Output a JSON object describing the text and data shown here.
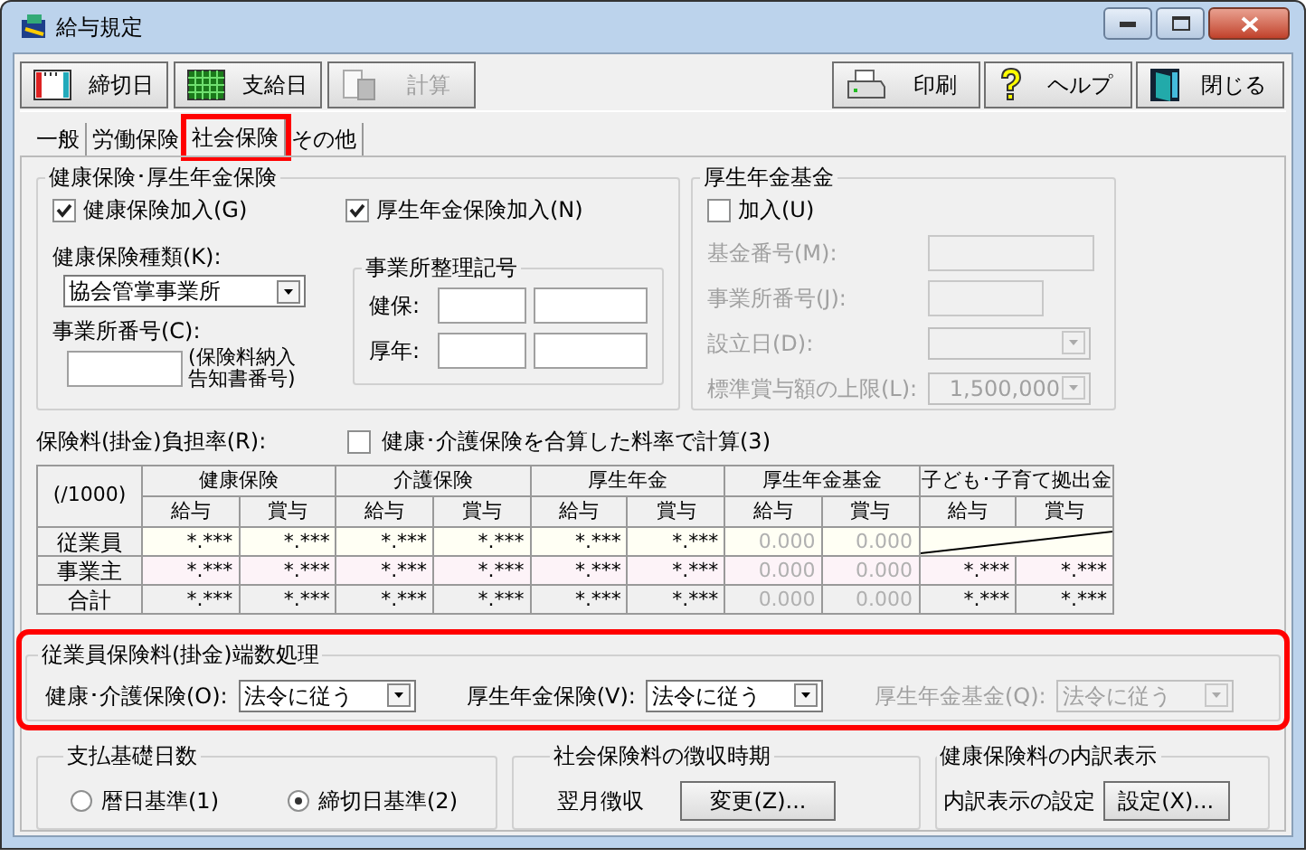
{
  "window": {
    "title": "給与規定"
  },
  "toolbar_left": [
    {
      "label": "締切日",
      "kind": "cutoff",
      "disabled": false
    },
    {
      "label": "支給日",
      "kind": "payday",
      "disabled": false
    },
    {
      "label": "計算",
      "kind": "calc",
      "disabled": true
    }
  ],
  "toolbar_right": [
    {
      "label": "印刷",
      "kind": "print"
    },
    {
      "label": "ヘルプ",
      "kind": "help"
    },
    {
      "label": "閉じる",
      "kind": "close"
    }
  ],
  "tabs": [
    {
      "label": "一般",
      "selected": false,
      "highlighted": false
    },
    {
      "label": "労働保険",
      "selected": false,
      "highlighted": false
    },
    {
      "label": "社会保険",
      "selected": true,
      "highlighted": true
    },
    {
      "label": "その他",
      "selected": false,
      "highlighted": false
    }
  ],
  "health_pension": {
    "title": "健康保険･厚生年金保険",
    "checks": [
      {
        "label": "健康保険加入(G)",
        "checked": true
      },
      {
        "label": "厚生年金保険加入(N)",
        "checked": true
      }
    ],
    "type_label": "健康保険種類(K):",
    "type_value": "協会管掌事業所",
    "office_label": "事業所番号(C):",
    "office_note": "(保険料納入告知書番号)",
    "symbol": {
      "title": "事業所整理記号",
      "rows": [
        {
          "label": "健保:"
        },
        {
          "label": "厚年:"
        }
      ]
    }
  },
  "pension_fund": {
    "title": "厚生年金基金",
    "join": {
      "label": "加入(U)",
      "checked": false
    },
    "fields": [
      {
        "label": "基金番号(M):",
        "kind": "input",
        "disabled": true
      },
      {
        "label": "事業所番号(J):",
        "kind": "input",
        "disabled": true
      },
      {
        "label": "設立日(D):",
        "kind": "select",
        "disabled": true
      },
      {
        "label": "標準賞与額の上限(L):",
        "kind": "select",
        "value": "1,500,000",
        "disabled": true
      }
    ]
  },
  "rates": {
    "label": "保険料(掛金)負担率(R):",
    "combine": {
      "label": "健康･介護保険を合算した料率で計算(3)",
      "checked": false
    },
    "corner": "(/1000)",
    "groups": [
      {
        "label": "健康保険",
        "subs": [
          "給与",
          "賞与"
        ]
      },
      {
        "label": "介護保険",
        "subs": [
          "給与",
          "賞与"
        ]
      },
      {
        "label": "厚生年金",
        "subs": [
          "給与",
          "賞与"
        ]
      },
      {
        "label": "厚生年金基金",
        "subs": [
          "給与",
          "賞与"
        ]
      },
      {
        "label": "子ども･子育て拠出金",
        "subs": [
          "給与",
          "賞与"
        ]
      }
    ],
    "rows": [
      {
        "label": "従業員",
        "kind": "employee",
        "cells": [
          {
            "kind": "value",
            "text": "*.***",
            "disabled": false
          },
          {
            "kind": "value",
            "text": "*.***",
            "disabled": false
          },
          {
            "kind": "value",
            "text": "*.***",
            "disabled": false
          },
          {
            "kind": "value",
            "text": "*.***",
            "disabled": false
          },
          {
            "kind": "value",
            "text": "*.***",
            "disabled": false
          },
          {
            "kind": "value",
            "text": "*.***",
            "disabled": false
          },
          {
            "kind": "value",
            "text": "0.000",
            "disabled": true
          },
          {
            "kind": "value",
            "text": "0.000",
            "disabled": true
          },
          {
            "kind": "slash"
          }
        ]
      },
      {
        "label": "事業主",
        "kind": "employer",
        "cells": [
          {
            "kind": "value",
            "text": "*.***",
            "disabled": false
          },
          {
            "kind": "value",
            "text": "*.***",
            "disabled": false
          },
          {
            "kind": "value",
            "text": "*.***",
            "disabled": false
          },
          {
            "kind": "value",
            "text": "*.***",
            "disabled": false
          },
          {
            "kind": "value",
            "text": "*.***",
            "disabled": false
          },
          {
            "kind": "value",
            "text": "*.***",
            "disabled": false
          },
          {
            "kind": "value",
            "text": "0.000",
            "disabled": true
          },
          {
            "kind": "value",
            "text": "0.000",
            "disabled": true
          },
          {
            "kind": "value",
            "text": "*.***",
            "disabled": false
          },
          {
            "kind": "value",
            "text": "*.***",
            "disabled": false
          }
        ]
      },
      {
        "label": "合計",
        "kind": "total",
        "cells": [
          {
            "kind": "value",
            "text": "*.***",
            "disabled": false
          },
          {
            "kind": "value",
            "text": "*.***",
            "disabled": false
          },
          {
            "kind": "value",
            "text": "*.***",
            "disabled": false
          },
          {
            "kind": "value",
            "text": "*.***",
            "disabled": false
          },
          {
            "kind": "value",
            "text": "*.***",
            "disabled": false
          },
          {
            "kind": "value",
            "text": "*.***",
            "disabled": false
          },
          {
            "kind": "value",
            "text": "0.000",
            "disabled": true
          },
          {
            "kind": "value",
            "text": "0.000",
            "disabled": true
          },
          {
            "kind": "value",
            "text": "*.***",
            "disabled": false
          },
          {
            "kind": "value",
            "text": "*.***",
            "disabled": false
          }
        ]
      }
    ]
  },
  "rounding": {
    "title": "従業員保険料(掛金)端数処理",
    "highlighted": true,
    "items": [
      {
        "label": "健康･介護保険(O):",
        "value": "法令に従う",
        "disabled": false
      },
      {
        "label": "厚生年金保険(V):",
        "value": "法令に従う",
        "disabled": false
      },
      {
        "label": "厚生年金基金(Q):",
        "value": "法令に従う",
        "disabled": true
      }
    ]
  },
  "pay_days": {
    "title": "支払基礎日数",
    "options": [
      {
        "label": "暦日基準(1)",
        "selected": false
      },
      {
        "label": "締切日基準(2)",
        "selected": true
      }
    ]
  },
  "collection": {
    "title": "社会保険料の徴収時期",
    "value": "翌月徴収",
    "button": "変更(Z)..."
  },
  "breakdown": {
    "title": "健康保険料の内訳表示",
    "label": "内訳表示の設定",
    "button": "設定(X)..."
  }
}
